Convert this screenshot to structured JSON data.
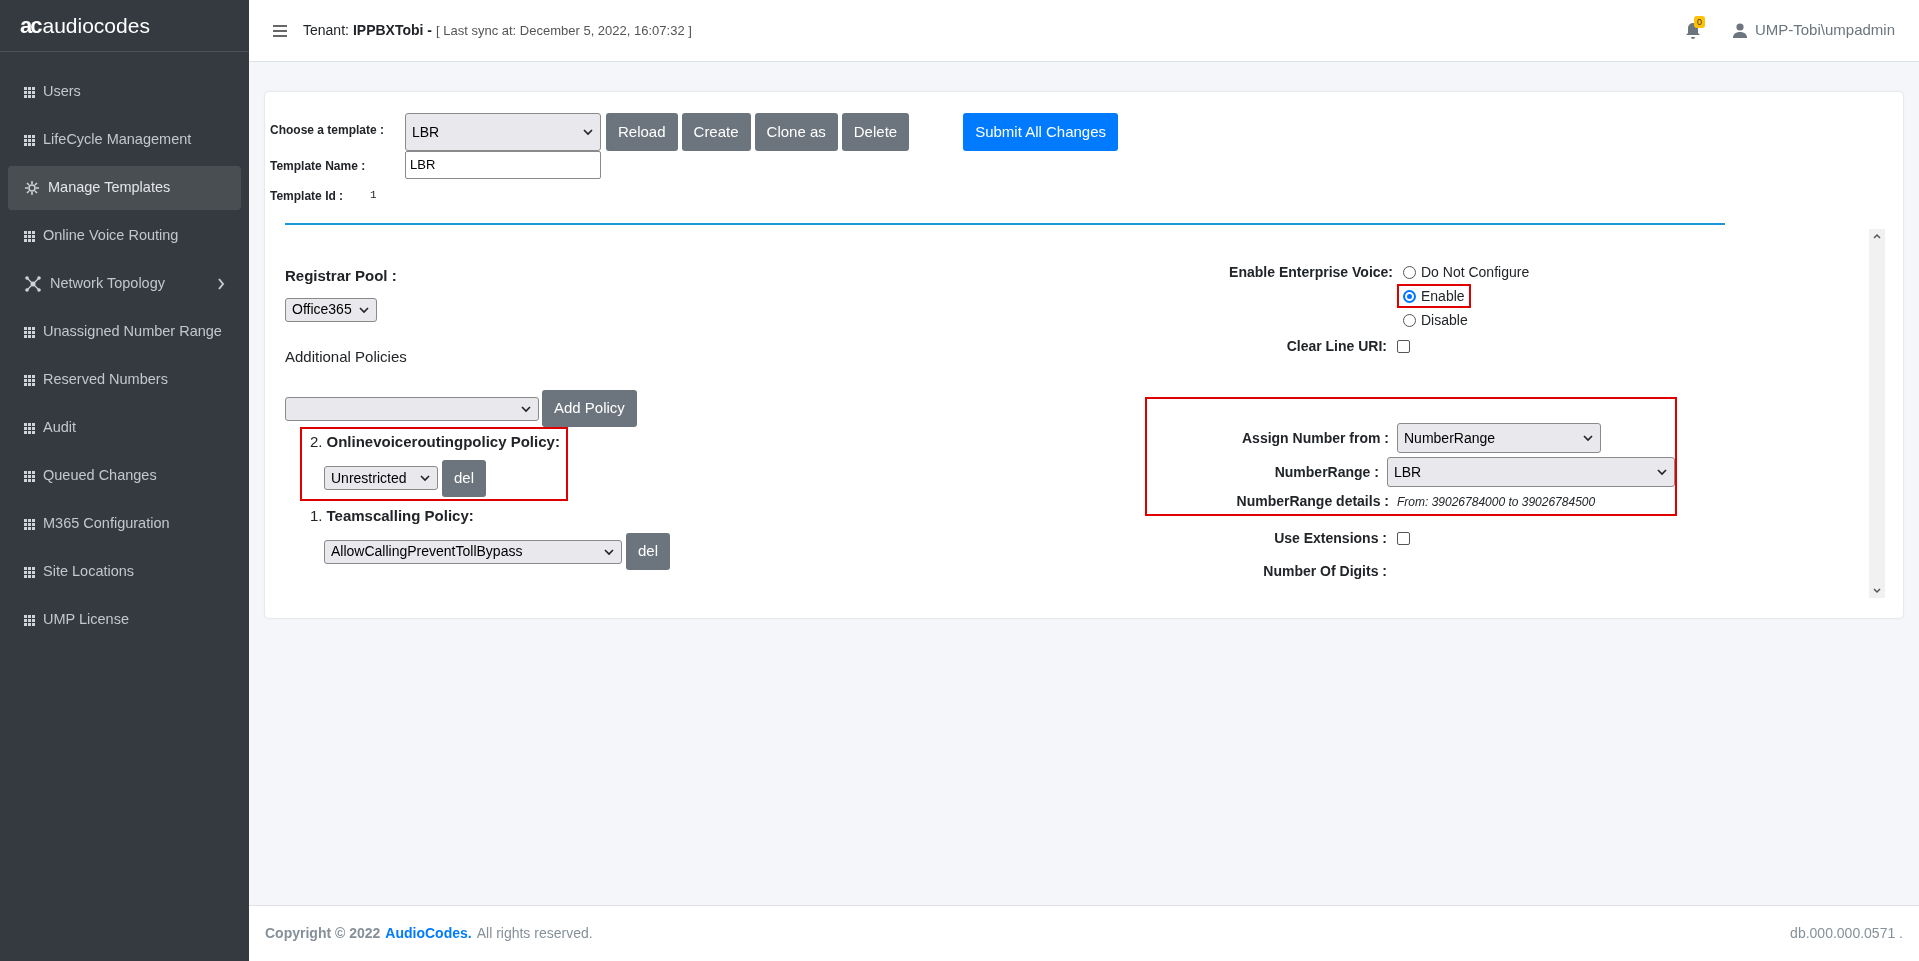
{
  "logo": {
    "mark": "ac",
    "text": "audiocodes"
  },
  "sidebar": {
    "items": [
      {
        "label": "Users",
        "kind": "grid",
        "selected": false,
        "has_submenu": false
      },
      {
        "label": "LifeCycle Management",
        "kind": "grid",
        "selected": false,
        "has_submenu": false
      },
      {
        "label": "Manage Templates",
        "kind": "gear",
        "selected": true,
        "has_submenu": false
      },
      {
        "label": "Online Voice Routing",
        "kind": "grid",
        "selected": false,
        "has_submenu": false
      },
      {
        "label": "Network Topology",
        "kind": "network",
        "selected": false,
        "has_submenu": true
      },
      {
        "label": "Unassigned Number Range",
        "kind": "grid",
        "selected": false,
        "has_submenu": false
      },
      {
        "label": "Reserved Numbers",
        "kind": "grid",
        "selected": false,
        "has_submenu": false
      },
      {
        "label": "Audit",
        "kind": "grid",
        "selected": false,
        "has_submenu": false
      },
      {
        "label": "Queued Changes",
        "kind": "grid",
        "selected": false,
        "has_submenu": false
      },
      {
        "label": "M365 Configuration",
        "kind": "grid",
        "selected": false,
        "has_submenu": false
      },
      {
        "label": "Site Locations",
        "kind": "grid",
        "selected": false,
        "has_submenu": false
      },
      {
        "label": "UMP License",
        "kind": "grid",
        "selected": false,
        "has_submenu": false
      }
    ]
  },
  "header": {
    "tenant_label": "Tenant:",
    "tenant": "IPPBXTobi -",
    "sync": "[ Last sync at: December 5, 2022, 16:07:32 ]",
    "notifications": "0",
    "user": "UMP-Tobi\\umpadmin"
  },
  "template": {
    "choose_label": "Choose a template :",
    "choose_value": "LBR",
    "name_label": "Template Name :",
    "name_value": "LBR",
    "id_label": "Template Id :",
    "id_value": "1",
    "buttons": [
      {
        "label": "Reload",
        "kind": "secondary"
      },
      {
        "label": "Create",
        "kind": "secondary"
      },
      {
        "label": "Clone as",
        "kind": "secondary"
      },
      {
        "label": "Delete",
        "kind": "secondary"
      },
      {
        "label": "Submit All Changes",
        "kind": "primary"
      }
    ]
  },
  "left": {
    "registrar_label": "Registrar Pool :",
    "registrar_value": "Office365",
    "additional_label": "Additional Policies",
    "add_button": "Add Policy",
    "policies": [
      {
        "number": "2.",
        "name": "Onlinevoiceroutingpolicy Policy:",
        "value": "Unrestricted",
        "del": "del",
        "highlighted": true
      },
      {
        "number": "1.",
        "name": "Teamscalling Policy:",
        "value": "AllowCallingPreventTollBypass",
        "del": "del",
        "highlighted": false
      }
    ]
  },
  "right": {
    "voice_label": "Enable Enterprise Voice:",
    "voice_options": [
      {
        "label": "Do Not Configure",
        "selected": false,
        "highlighted": false
      },
      {
        "label": "Enable",
        "selected": true,
        "highlighted": true
      },
      {
        "label": "Disable",
        "selected": false,
        "highlighted": false
      }
    ],
    "clear_line_label": "Clear Line URI:",
    "clear_line_checked": false,
    "assign_label": "Assign Number from :",
    "assign_value": "NumberRange",
    "range_label": "NumberRange :",
    "range_value": "LBR",
    "details_label": "NumberRange details :",
    "details_value": "From: 39026784000 to 39026784500",
    "assign_highlighted": true,
    "extensions_label": "Use Extensions :",
    "extensions_checked": false,
    "digits_label": "Number Of Digits :"
  },
  "footer": {
    "copyright": "Copyright © 2022",
    "brand": "AudioCodes.",
    "rights": "All rights reserved.",
    "version": "db.000.000.0571 ."
  }
}
